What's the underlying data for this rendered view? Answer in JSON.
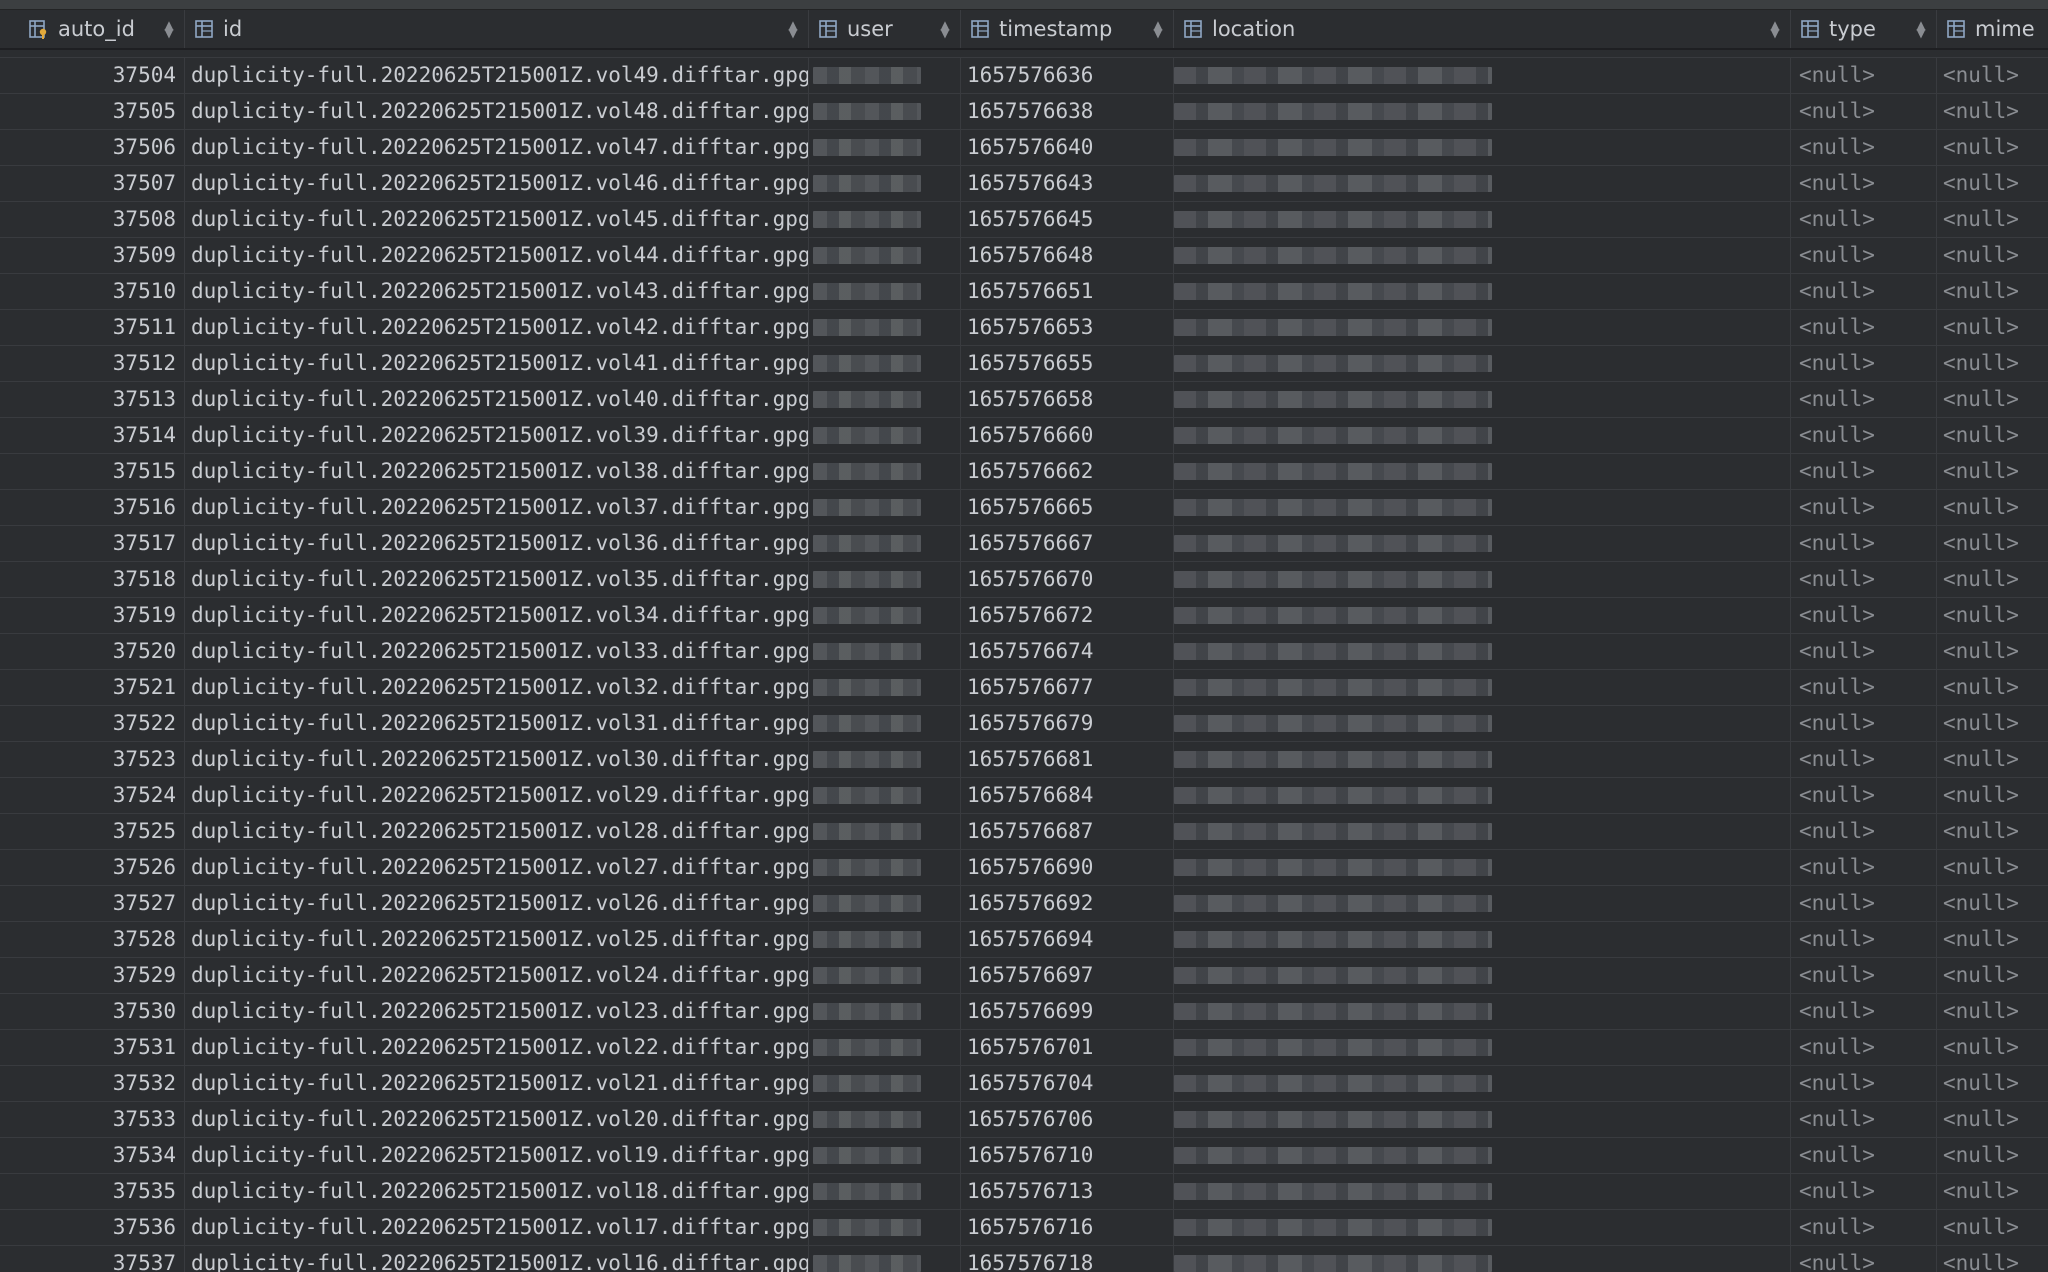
{
  "columns": [
    {
      "key": "auto_id",
      "label": "auto_id",
      "icon": "key-column-icon"
    },
    {
      "key": "id",
      "label": "id",
      "icon": "table-column-icon"
    },
    {
      "key": "user",
      "label": "user",
      "icon": "table-column-icon"
    },
    {
      "key": "timestamp",
      "label": "timestamp",
      "icon": "table-column-icon"
    },
    {
      "key": "location",
      "label": "location",
      "icon": "table-column-icon"
    },
    {
      "key": "type",
      "label": "type",
      "icon": "table-column-icon"
    },
    {
      "key": "mime",
      "label": "mime",
      "icon": "table-column-icon"
    }
  ],
  "null_label": "<null>",
  "rows": [
    {
      "auto_id": "37504",
      "id": "duplicity-full.20220625T215001Z.vol49.difftar.gpg",
      "timestamp": "1657576636"
    },
    {
      "auto_id": "37505",
      "id": "duplicity-full.20220625T215001Z.vol48.difftar.gpg",
      "timestamp": "1657576638"
    },
    {
      "auto_id": "37506",
      "id": "duplicity-full.20220625T215001Z.vol47.difftar.gpg",
      "timestamp": "1657576640"
    },
    {
      "auto_id": "37507",
      "id": "duplicity-full.20220625T215001Z.vol46.difftar.gpg",
      "timestamp": "1657576643"
    },
    {
      "auto_id": "37508",
      "id": "duplicity-full.20220625T215001Z.vol45.difftar.gpg",
      "timestamp": "1657576645"
    },
    {
      "auto_id": "37509",
      "id": "duplicity-full.20220625T215001Z.vol44.difftar.gpg",
      "timestamp": "1657576648"
    },
    {
      "auto_id": "37510",
      "id": "duplicity-full.20220625T215001Z.vol43.difftar.gpg",
      "timestamp": "1657576651"
    },
    {
      "auto_id": "37511",
      "id": "duplicity-full.20220625T215001Z.vol42.difftar.gpg",
      "timestamp": "1657576653"
    },
    {
      "auto_id": "37512",
      "id": "duplicity-full.20220625T215001Z.vol41.difftar.gpg",
      "timestamp": "1657576655"
    },
    {
      "auto_id": "37513",
      "id": "duplicity-full.20220625T215001Z.vol40.difftar.gpg",
      "timestamp": "1657576658"
    },
    {
      "auto_id": "37514",
      "id": "duplicity-full.20220625T215001Z.vol39.difftar.gpg",
      "timestamp": "1657576660"
    },
    {
      "auto_id": "37515",
      "id": "duplicity-full.20220625T215001Z.vol38.difftar.gpg",
      "timestamp": "1657576662"
    },
    {
      "auto_id": "37516",
      "id": "duplicity-full.20220625T215001Z.vol37.difftar.gpg",
      "timestamp": "1657576665"
    },
    {
      "auto_id": "37517",
      "id": "duplicity-full.20220625T215001Z.vol36.difftar.gpg",
      "timestamp": "1657576667"
    },
    {
      "auto_id": "37518",
      "id": "duplicity-full.20220625T215001Z.vol35.difftar.gpg",
      "timestamp": "1657576670"
    },
    {
      "auto_id": "37519",
      "id": "duplicity-full.20220625T215001Z.vol34.difftar.gpg",
      "timestamp": "1657576672"
    },
    {
      "auto_id": "37520",
      "id": "duplicity-full.20220625T215001Z.vol33.difftar.gpg",
      "timestamp": "1657576674"
    },
    {
      "auto_id": "37521",
      "id": "duplicity-full.20220625T215001Z.vol32.difftar.gpg",
      "timestamp": "1657576677"
    },
    {
      "auto_id": "37522",
      "id": "duplicity-full.20220625T215001Z.vol31.difftar.gpg",
      "timestamp": "1657576679"
    },
    {
      "auto_id": "37523",
      "id": "duplicity-full.20220625T215001Z.vol30.difftar.gpg",
      "timestamp": "1657576681"
    },
    {
      "auto_id": "37524",
      "id": "duplicity-full.20220625T215001Z.vol29.difftar.gpg",
      "timestamp": "1657576684"
    },
    {
      "auto_id": "37525",
      "id": "duplicity-full.20220625T215001Z.vol28.difftar.gpg",
      "timestamp": "1657576687"
    },
    {
      "auto_id": "37526",
      "id": "duplicity-full.20220625T215001Z.vol27.difftar.gpg",
      "timestamp": "1657576690"
    },
    {
      "auto_id": "37527",
      "id": "duplicity-full.20220625T215001Z.vol26.difftar.gpg",
      "timestamp": "1657576692"
    },
    {
      "auto_id": "37528",
      "id": "duplicity-full.20220625T215001Z.vol25.difftar.gpg",
      "timestamp": "1657576694"
    },
    {
      "auto_id": "37529",
      "id": "duplicity-full.20220625T215001Z.vol24.difftar.gpg",
      "timestamp": "1657576697"
    },
    {
      "auto_id": "37530",
      "id": "duplicity-full.20220625T215001Z.vol23.difftar.gpg",
      "timestamp": "1657576699"
    },
    {
      "auto_id": "37531",
      "id": "duplicity-full.20220625T215001Z.vol22.difftar.gpg",
      "timestamp": "1657576701"
    },
    {
      "auto_id": "37532",
      "id": "duplicity-full.20220625T215001Z.vol21.difftar.gpg",
      "timestamp": "1657576704"
    },
    {
      "auto_id": "37533",
      "id": "duplicity-full.20220625T215001Z.vol20.difftar.gpg",
      "timestamp": "1657576706"
    },
    {
      "auto_id": "37534",
      "id": "duplicity-full.20220625T215001Z.vol19.difftar.gpg",
      "timestamp": "1657576710"
    },
    {
      "auto_id": "37535",
      "id": "duplicity-full.20220625T215001Z.vol18.difftar.gpg",
      "timestamp": "1657576713"
    },
    {
      "auto_id": "37536",
      "id": "duplicity-full.20220625T215001Z.vol17.difftar.gpg",
      "timestamp": "1657576716"
    },
    {
      "auto_id": "37537",
      "id": "duplicity-full.20220625T215001Z.vol16.difftar.gpg",
      "timestamp": "1657576718"
    }
  ]
}
